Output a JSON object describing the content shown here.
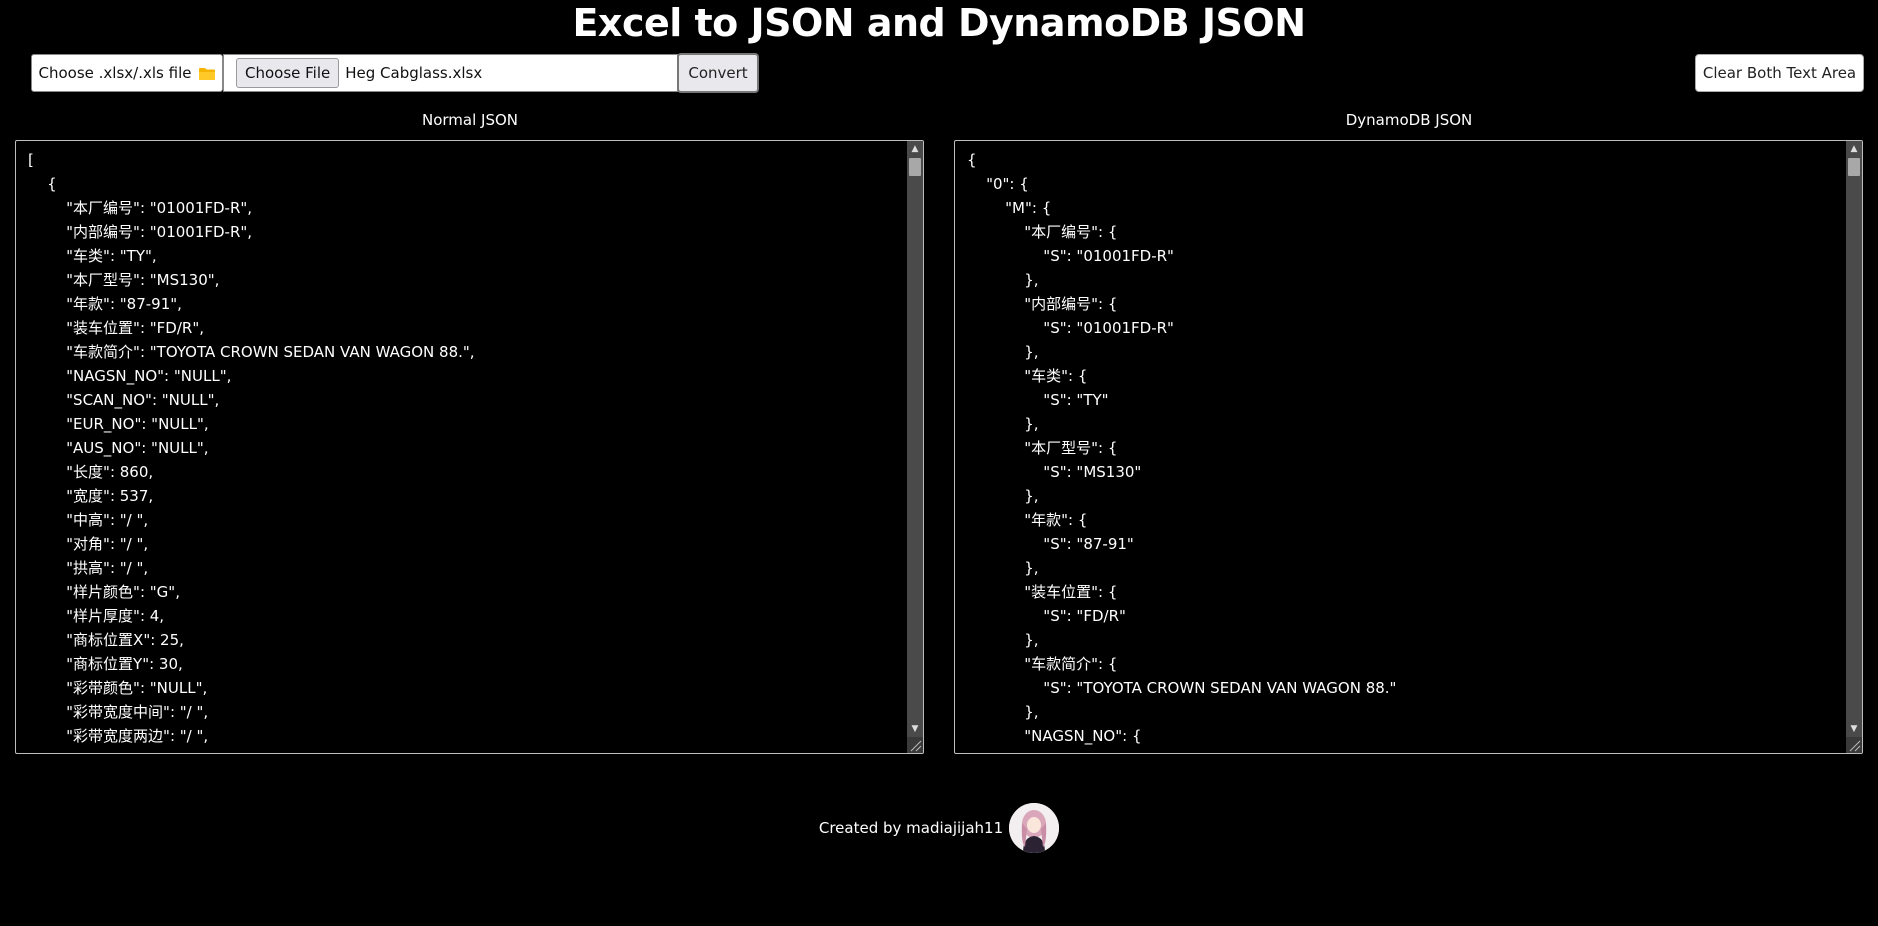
{
  "header": {
    "title": "Excel to JSON and DynamoDB JSON"
  },
  "toolbar": {
    "choose_label": "Choose .xlsx/.xls file",
    "folder_icon": "folder-icon",
    "file_button_label": "Choose File",
    "file_name": "Heg Cabglass.xlsx",
    "convert_label": "Convert",
    "clear_label": "Clear Both Text Area"
  },
  "panels": {
    "normal": {
      "heading": "Normal JSON",
      "lines": [
        "[",
        "    {",
        "        \"本厂编号\": \"01001FD-R\",",
        "        \"内部编号\": \"01001FD-R\",",
        "        \"车类\": \"TY\",",
        "        \"本厂型号\": \"MS130\",",
        "        \"年款\": \"87-91\",",
        "        \"装车位置\": \"FD/R\",",
        "        \"车款简介\": \"TOYOTA CROWN SEDAN VAN WAGON 88.\",",
        "        \"NAGSN_NO\": \"NULL\",",
        "        \"SCAN_NO\": \"NULL\",",
        "        \"EUR_NO\": \"NULL\",",
        "        \"AUS_NO\": \"NULL\",",
        "        \"长度\": 860,",
        "        \"宽度\": 537,",
        "        \"中高\": \"/ \",",
        "        \"对角\": \"/ \",",
        "        \"拱高\": \"/ \",",
        "        \"样片颜色\": \"G\",",
        "        \"样片厚度\": 4,",
        "        \"商标位置X\": 25,",
        "        \"商标位置Y\": 30,",
        "        \"彩带颜色\": \"NULL\",",
        "        \"彩带宽度中间\": \"/ \",",
        "        \"彩带宽度两边\": \"/ \","
      ]
    },
    "dynamo": {
      "heading": "DynamoDB JSON",
      "lines": [
        "{",
        "    \"0\": {",
        "        \"M\": {",
        "            \"本厂编号\": {",
        "                \"S\": \"01001FD-R\"",
        "            },",
        "            \"内部编号\": {",
        "                \"S\": \"01001FD-R\"",
        "            },",
        "            \"车类\": {",
        "                \"S\": \"TY\"",
        "            },",
        "            \"本厂型号\": {",
        "                \"S\": \"MS130\"",
        "            },",
        "            \"年款\": {",
        "                \"S\": \"87-91\"",
        "            },",
        "            \"装车位置\": {",
        "                \"S\": \"FD/R\"",
        "            },",
        "            \"车款简介\": {",
        "                \"S\": \"TOYOTA CROWN SEDAN VAN WAGON 88.\"",
        "            },",
        "            \"NAGSN_NO\": {"
      ]
    }
  },
  "footer": {
    "credit": "Created by madiajijah11"
  }
}
